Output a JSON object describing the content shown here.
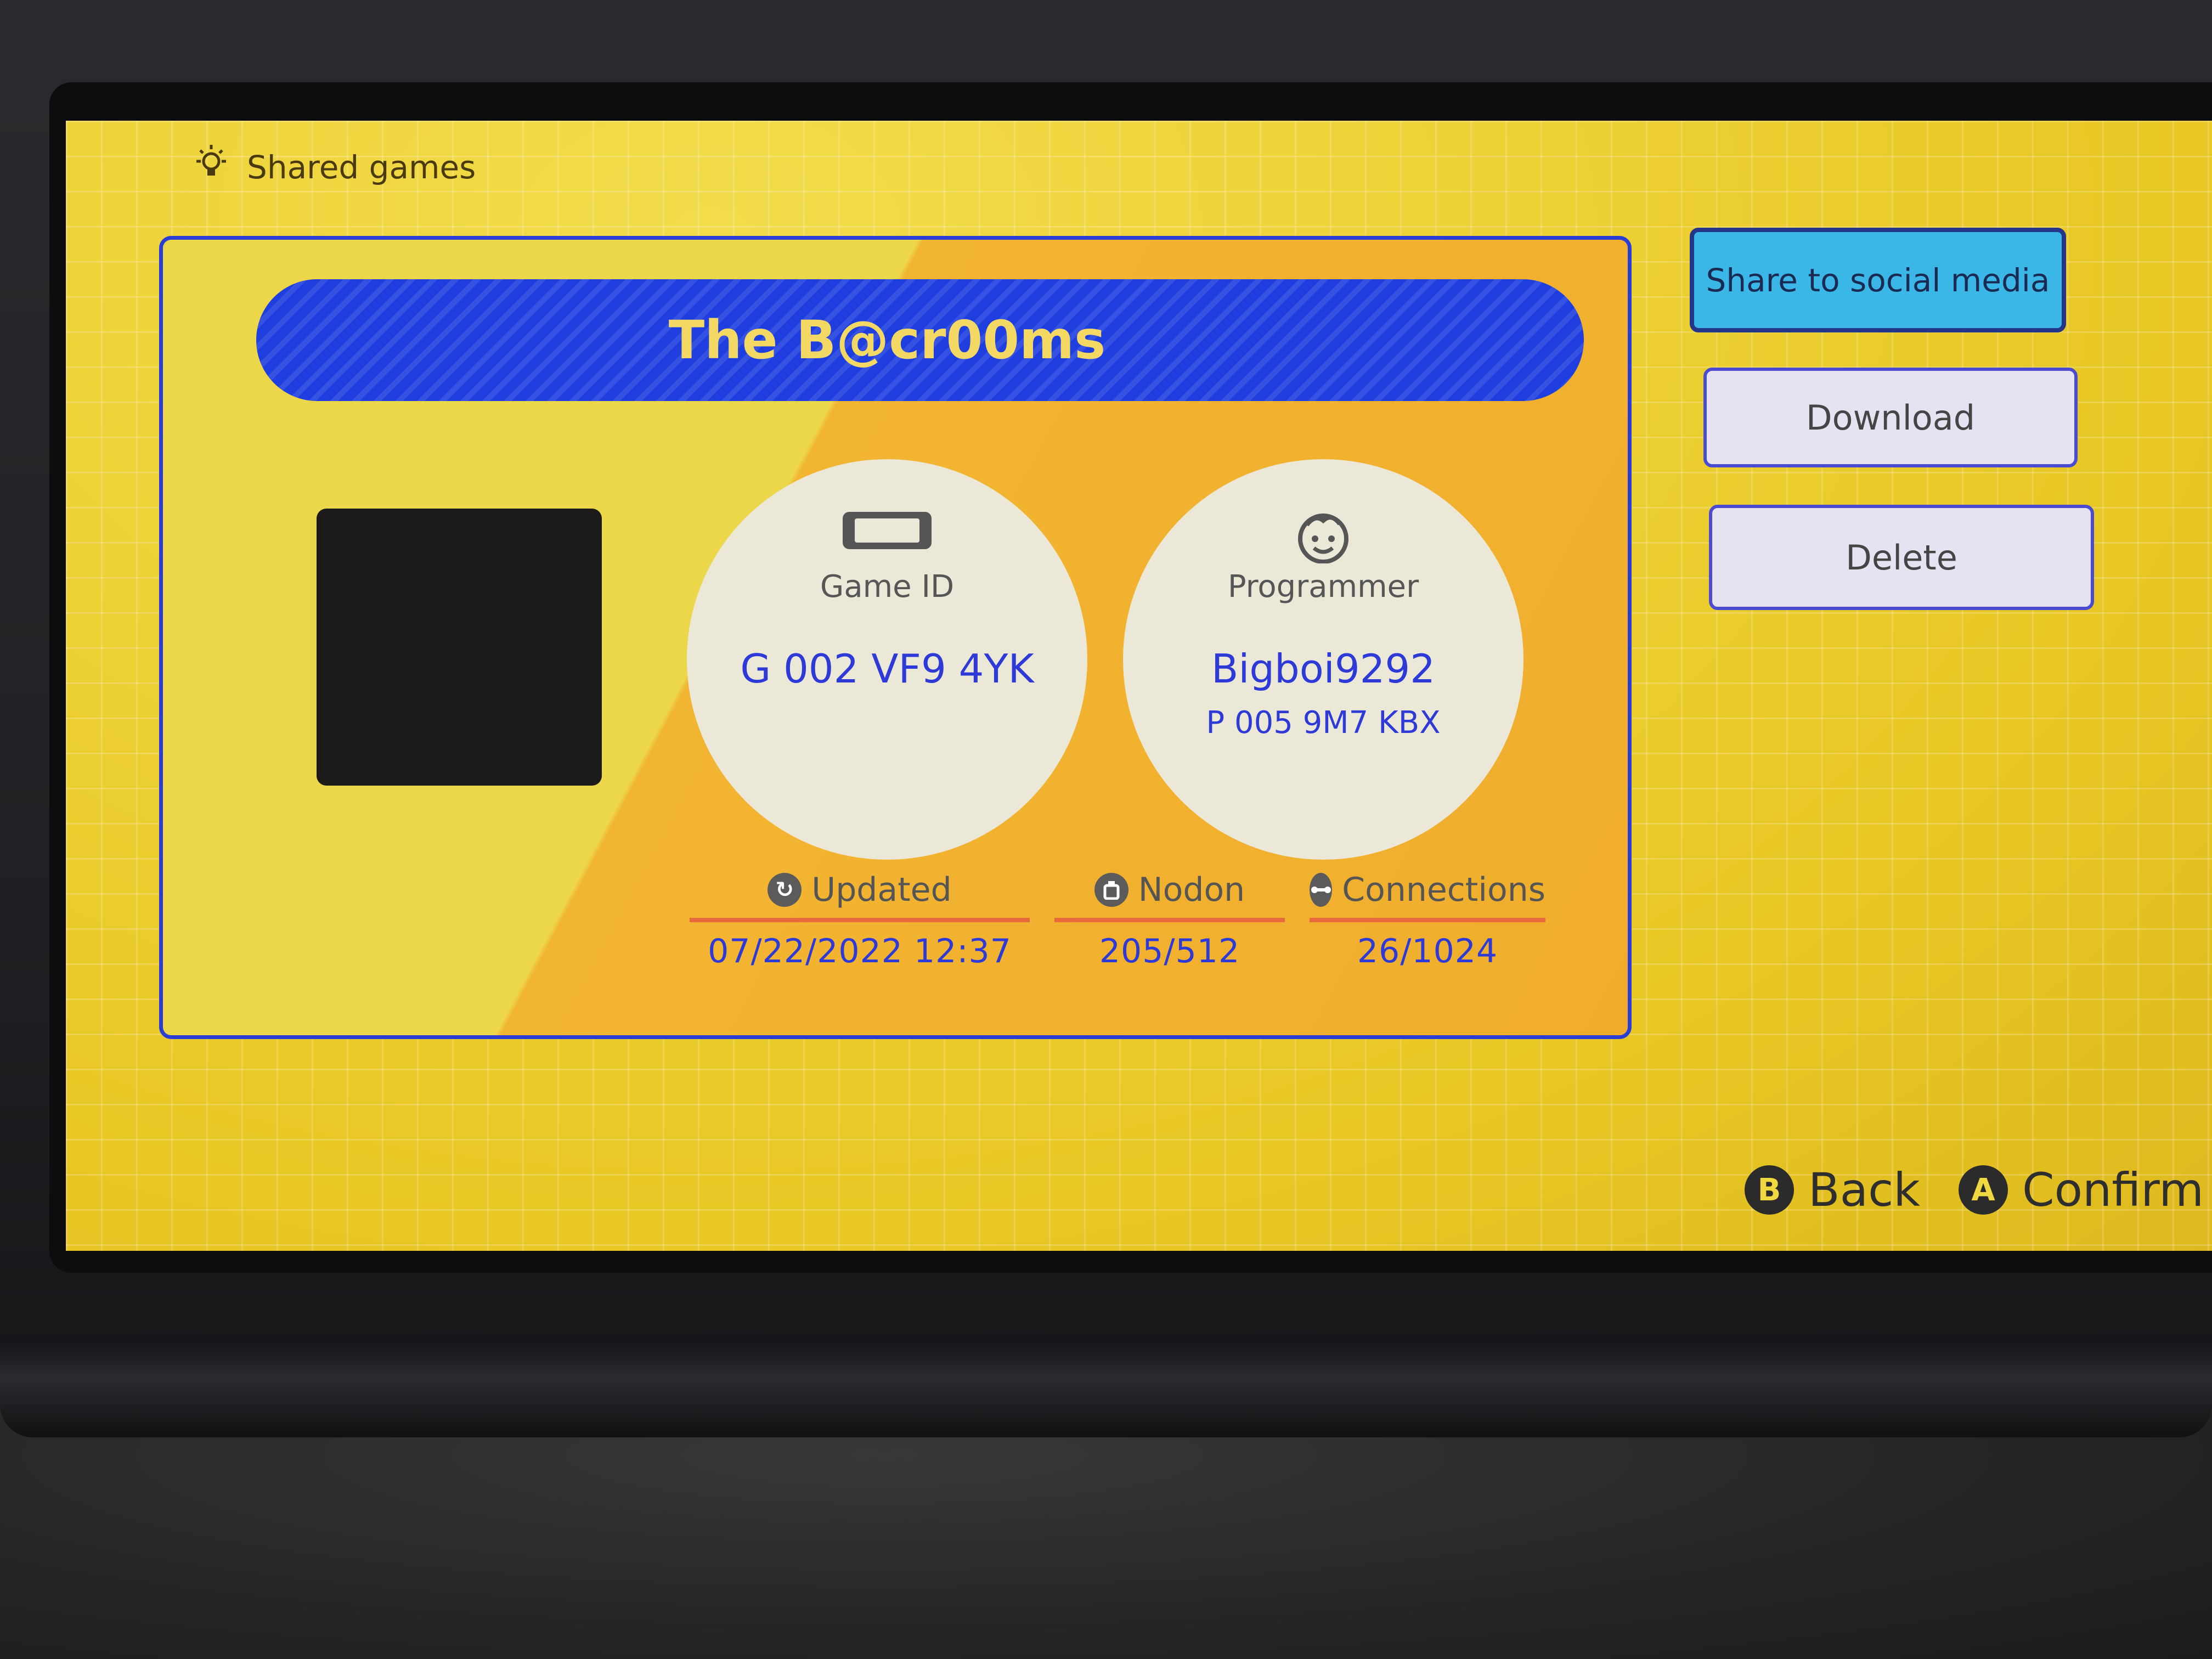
{
  "header": {
    "title": "Shared games",
    "icon": "lightbulb-icon"
  },
  "game": {
    "title": "The B@cr00ms",
    "game_id_label": "Game ID",
    "game_id": "G 002 VF9 4YK",
    "programmer_label": "Programmer",
    "programmer_name": "Bigboi9292",
    "programmer_id": "P 005 9M7 KBX"
  },
  "stats": {
    "updated_label": "Updated",
    "updated_value": "07/22/2022 12:37",
    "nodon_label": "Nodon",
    "nodon_value": "205/512",
    "connections_label": "Connections",
    "connections_value": "26/1024"
  },
  "actions": {
    "share_label": "Share to social media",
    "download_label": "Download",
    "delete_label": "Delete"
  },
  "footer": {
    "back_button": "B",
    "back_label": "Back",
    "confirm_button": "A",
    "confirm_label": "Confirm"
  },
  "colors": {
    "screen_yellow": "#ecd32a",
    "panel_border": "#2a3ed6",
    "title_bar": "#1e3ee0",
    "value_blue": "#2d3ad8",
    "share_button": "#3ab7e6",
    "underline": "#e86a3c"
  }
}
